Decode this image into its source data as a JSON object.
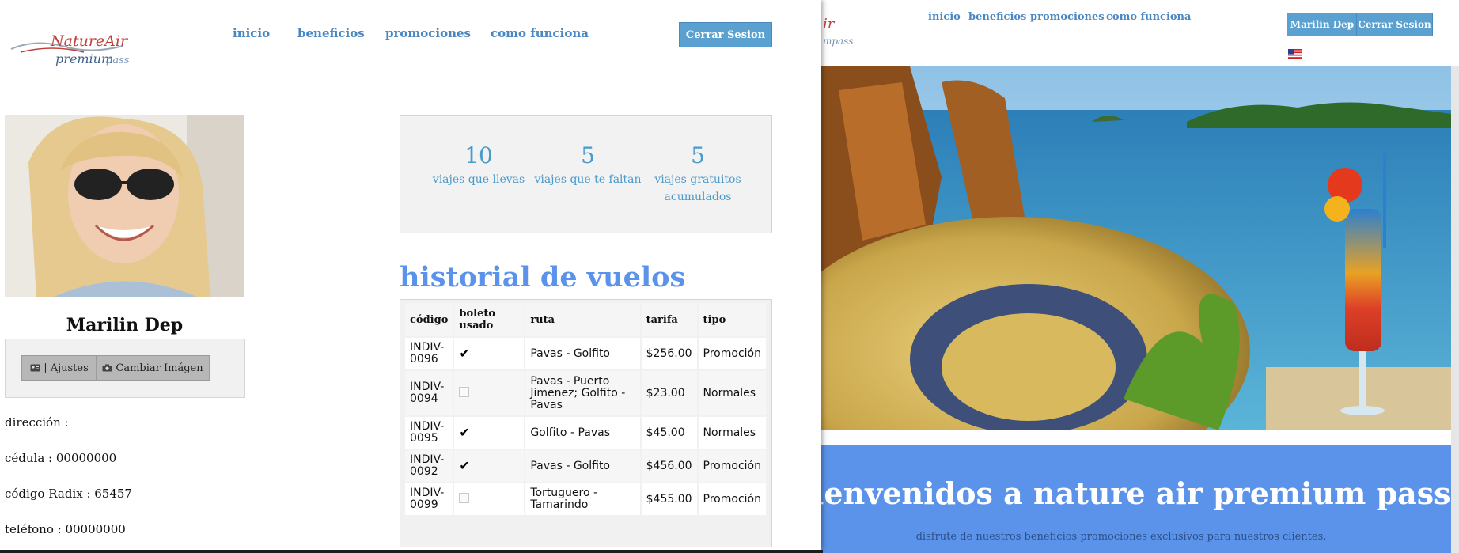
{
  "background_page": {
    "nav": [
      "inicio",
      "beneficios",
      "promociones",
      "como funciona"
    ],
    "user_button": "Marilin Dep",
    "logout_button": "Cerrar Sesion",
    "banner_title": "bienvenidos a nature air premium pass",
    "banner_subtitle": "disfrute de nuestros beneficios promociones exclusivos para nuestros clientes.",
    "colors": {
      "banner": "#5b93ea",
      "button": "#5aa0d0",
      "nav": "#4a87c2"
    }
  },
  "foreground": {
    "brand": {
      "logo_text": "NatureAir",
      "logo_sub_a": "premium",
      "logo_sub_b": "pass"
    },
    "nav": [
      "inicio",
      "beneficios",
      "promociones",
      "como funciona"
    ],
    "logout_button": "Cerrar Sesion",
    "profile": {
      "name": "Marilin Dep",
      "settings_button": "| Ajustes",
      "change_image_button": "Cambiar Imágen",
      "fields": [
        "dirección :",
        "cédula : 00000000",
        "código Radix : 65457",
        "teléfono : 00000000"
      ]
    },
    "stats": [
      {
        "value": "10",
        "label": "viajes que llevas"
      },
      {
        "value": "5",
        "label": "viajes que te faltan"
      },
      {
        "value": "5",
        "label": "viajes gratuitos acumulados"
      }
    ],
    "history": {
      "title": "historial de vuelos",
      "columns": [
        "código",
        "boleto usado",
        "ruta",
        "tarifa",
        "tipo"
      ],
      "rows": [
        {
          "code": "INDIV-0096",
          "used": true,
          "route": "Pavas - Golfito",
          "fare": "$256.00",
          "type": "Promoción"
        },
        {
          "code": "INDIV-0094",
          "used": false,
          "route": "Pavas - Puerto Jimenez; Golfito - Pavas",
          "fare": "$23.00",
          "type": "Normales"
        },
        {
          "code": "INDIV-0095",
          "used": true,
          "route": "Golfito - Pavas",
          "fare": "$45.00",
          "type": "Normales"
        },
        {
          "code": "INDIV-0092",
          "used": true,
          "route": "Pavas - Golfito",
          "fare": "$456.00",
          "type": "Promoción"
        },
        {
          "code": "INDIV-0099",
          "used": false,
          "route": "Tortuguero - Tamarindo",
          "fare": "$455.00",
          "type": "Promoción"
        }
      ]
    },
    "icons": {
      "settings": "id-card-icon",
      "change_image": "camera-icon",
      "check": "checkmark-icon"
    },
    "colors": {
      "accent_title": "#5b93ea",
      "stat_text": "#4a9acb",
      "button": "#5aa0d0"
    }
  }
}
